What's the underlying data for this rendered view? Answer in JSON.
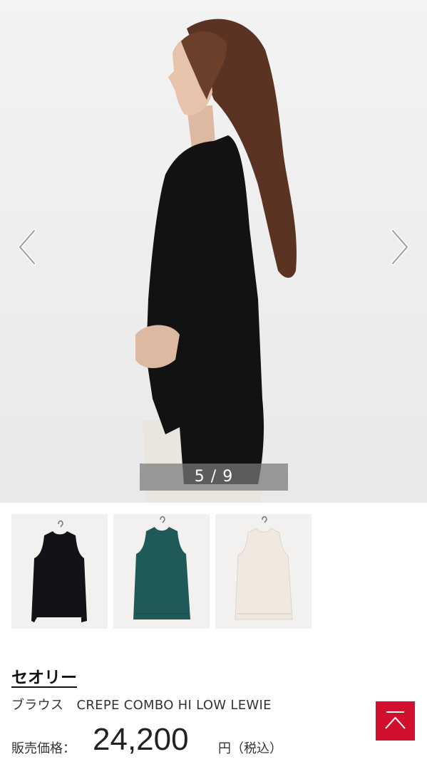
{
  "gallery": {
    "counter": "5 / 9",
    "prev_icon": "chevron-left-icon",
    "next_icon": "chevron-right-icon"
  },
  "thumbnails": [
    {
      "color_name": "black",
      "color": "#111317"
    },
    {
      "color_name": "teal",
      "color": "#1f5a59"
    },
    {
      "color_name": "ivory",
      "color": "#efe9df"
    }
  ],
  "product": {
    "brand": "セオリー",
    "name": "ブラウス　CREPE COMBO HI LOW LEWIE",
    "price_label": "販売価格：",
    "price": "24,200",
    "price_unit": "円（税込）"
  },
  "scroll_top": {
    "icon": "scroll-to-top-icon",
    "color": "#d0102d"
  }
}
